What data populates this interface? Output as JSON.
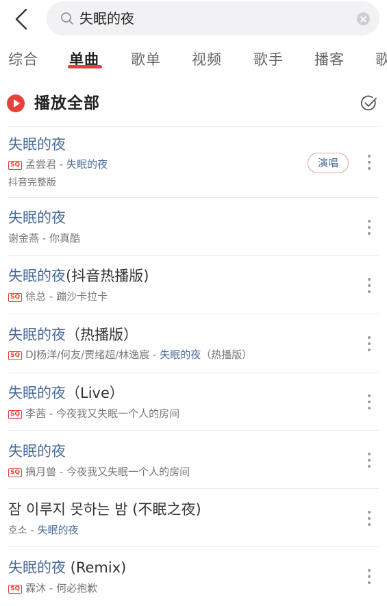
{
  "search": {
    "query": "失眠的夜"
  },
  "tabs": [
    {
      "label": "综合"
    },
    {
      "label": "单曲",
      "active": true
    },
    {
      "label": "歌单"
    },
    {
      "label": "视频"
    },
    {
      "label": "歌手"
    },
    {
      "label": "播客"
    },
    {
      "label": "歌"
    }
  ],
  "play_all": {
    "label": "播放全部"
  },
  "songs": [
    {
      "title_hl": "失眠的夜",
      "title_rest": "",
      "sq": true,
      "artist": "孟尝君",
      "sep": " - ",
      "album_hl": "失眠的夜",
      "album_rest": "",
      "extra": "抖音完整版",
      "sing_label": "演唱"
    },
    {
      "title_hl": "失眠的夜",
      "title_rest": "",
      "sq": false,
      "artist": "谢金燕",
      "sep": " - ",
      "album_hl": "",
      "album_rest": "你真酷"
    },
    {
      "title_hl": "失眠的夜",
      "title_rest": "(抖音热播版)",
      "sq": true,
      "artist": "徐总",
      "sep": " - ",
      "album_hl": "",
      "album_rest": "蹦沙卡拉卡"
    },
    {
      "title_hl": "失眠的夜",
      "title_rest": "（热播版）",
      "sq": true,
      "artist": "DJ杨洋/何友/贾绪超/林逸宸",
      "sep": " - ",
      "album_hl": "失眠的夜",
      "album_rest": "（热播版）"
    },
    {
      "title_hl": "失眠的夜",
      "title_rest": "（Live）",
      "sq": true,
      "artist": "李茜",
      "sep": " - ",
      "album_hl": "",
      "album_rest": "今夜我又失眠一个人的房间"
    },
    {
      "title_hl": "失眠的夜",
      "title_rest": "",
      "sq": true,
      "artist": "摘月兽",
      "sep": " - ",
      "album_hl": "",
      "album_rest": "今夜我又失眠一个人的房间"
    },
    {
      "title_hl": "",
      "title_rest": "잠 이루지 못하는 밤 (不眠之夜)",
      "sq": false,
      "artist": "호소",
      "sep": " - ",
      "album_hl": "失眠的夜",
      "album_rest": ""
    },
    {
      "title_hl": "失眠的夜",
      "title_rest": " (Remix)",
      "sq": true,
      "artist": "霖沐",
      "sep": " - ",
      "album_hl": "",
      "album_rest": "何必抱歉"
    }
  ],
  "badge_text": "SQ",
  "colors": {
    "accent": "#e8403a",
    "highlight": "#4a6b9a",
    "secondary_text": "#777777"
  },
  "icons": [
    "back-arrow-icon",
    "search-icon",
    "clear-icon",
    "play-icon",
    "multi-select-check-icon",
    "more-vertical-icon"
  ]
}
